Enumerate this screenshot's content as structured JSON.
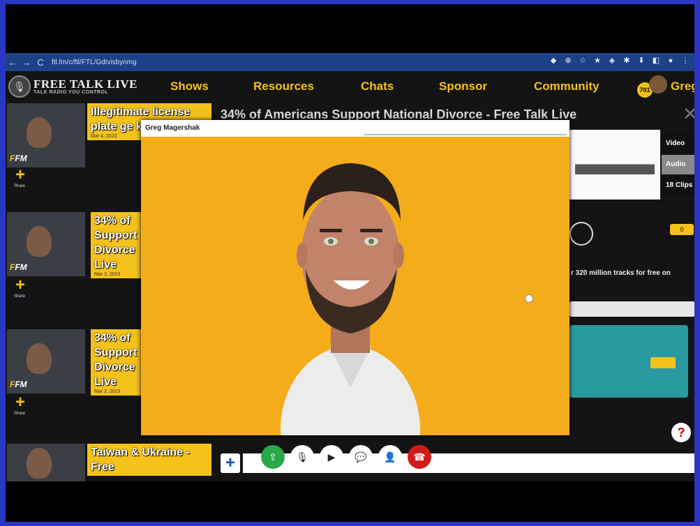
{
  "browser": {
    "url": "ftl.fm/c/ftl/FTL/Gdtvisbynmg",
    "nav_back": "←",
    "nav_forward": "→",
    "nav_reload": "C",
    "ext_icons": [
      "◆",
      "⊕",
      "☆",
      "★",
      "◈",
      "✱",
      "⬇",
      "◧",
      "●",
      "⋮"
    ]
  },
  "site": {
    "logo_title": "FREE TALK LIVE",
    "logo_tagline": "TALK RADIO YOU CONTROL",
    "nav": [
      "Shows",
      "Resources",
      "Chats",
      "Sponsor",
      "Community"
    ],
    "badge_count": "701",
    "user_name": "Greg"
  },
  "sidebar": {
    "items": [
      {
        "title": "Illegitimate license plate ge killed - Live",
        "date": "Mar 4, 2023",
        "fm": "FM",
        "share": "Share"
      },
      {
        "title": "34% of Support Divorce Live",
        "date": "Mar 3, 2023",
        "fm": "FM",
        "share": "Share"
      },
      {
        "title": "34% of Support Divorce Live",
        "date": "Mar 2, 2023",
        "fm": "FM",
        "share": "Share"
      },
      {
        "title": "Taiwan & Ukraine - Free",
        "date": "",
        "fm": "",
        "share": ""
      }
    ]
  },
  "main": {
    "title": "34% of Americans Support National Divorce - Free Talk Live",
    "close": "✕",
    "side_buttons": [
      {
        "label": "Video",
        "color": "#111111"
      },
      {
        "label": "Audio",
        "color": "#8a8a8a"
      },
      {
        "label": "18 Clips",
        "color": "#111111"
      }
    ],
    "counter": "0",
    "tracks_text": "r 320 million tracks for free on",
    "help": "?",
    "add": "+"
  },
  "modal": {
    "participant_name": "Greg Magershak",
    "background_color": "#f4ac1a"
  },
  "controls": [
    {
      "name": "screen-share-icon",
      "glyph": "⇪",
      "style": "green"
    },
    {
      "name": "microphone-icon",
      "glyph": "🎙",
      "style": "white"
    },
    {
      "name": "camera-icon",
      "glyph": "▶",
      "style": "white"
    },
    {
      "name": "chat-icon",
      "glyph": "💬",
      "style": "white"
    },
    {
      "name": "participants-icon",
      "glyph": "👤",
      "style": "white"
    },
    {
      "name": "hang-up-icon",
      "glyph": "☎",
      "style": "red"
    }
  ]
}
